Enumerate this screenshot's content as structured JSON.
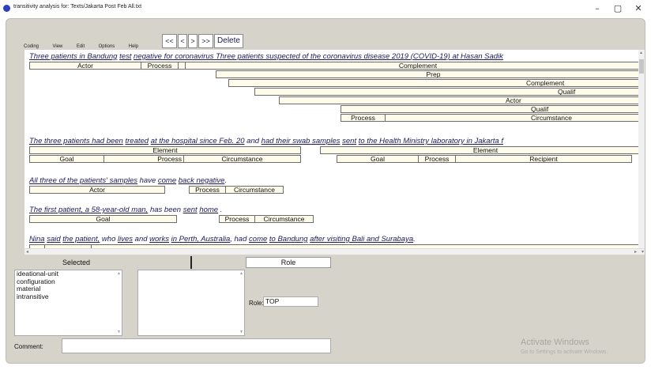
{
  "window": {
    "title": "transitivity analysis for: Texts/Jakarta Post Feb All.txt",
    "minimize": "–",
    "maximize": "▢",
    "close": "✕"
  },
  "menu": [
    "Coding",
    "View",
    "Edit",
    "Options",
    "Help"
  ],
  "toolbar": {
    "first": "<<",
    "prev": "<",
    "next": ">",
    "last": ">>",
    "delete": "Delete"
  },
  "sentences": [
    {
      "segments": [
        {
          "text": "Three patients in Bandung",
          "u": true
        },
        {
          "text": " ",
          "u": false
        },
        {
          "text": "test",
          "u": true
        },
        {
          "text": " ",
          "u": false
        },
        {
          "text": "negative for coronavirus Three patients suspected of the coronavirus disease 2019 (COVID-19) at Hasan Sadik",
          "u": true
        }
      ],
      "boxes": [
        "Actor",
        "Process",
        "",
        "Complement",
        "Prep",
        "Complement",
        "Qualif",
        "Actor",
        "Qualif",
        "Process",
        "Circumstance"
      ]
    },
    {
      "segments": [
        {
          "text": "The three patients had been",
          "u": true
        },
        {
          "text": " ",
          "u": false
        },
        {
          "text": "treated",
          "u": true
        },
        {
          "text": " ",
          "u": false
        },
        {
          "text": "at the hospital since Feb. 20",
          "u": true
        },
        {
          "text": " and ",
          "u": false
        },
        {
          "text": "had their swab samples",
          "u": true
        },
        {
          "text": "   ",
          "u": false
        },
        {
          "text": "sent",
          "u": true
        },
        {
          "text": "   ",
          "u": false
        },
        {
          "text": "to the Health Ministry laboratory in Jakarta f",
          "u": true
        }
      ],
      "boxes": [
        "Element",
        "Element",
        "Goal",
        "Process",
        "Circumstance",
        "Goal",
        "Process",
        "Recipient"
      ]
    },
    {
      "segments": [
        {
          "text": "All three of the patients' samples",
          "u": true
        },
        {
          "text": " have ",
          "u": false
        },
        {
          "text": "come",
          "u": true
        },
        {
          "text": "  ",
          "u": false
        },
        {
          "text": "back negative",
          "u": true
        },
        {
          "text": ".",
          "u": false
        }
      ],
      "boxes": [
        "Actor",
        "Process",
        "Circumstance"
      ]
    },
    {
      "segments": [
        {
          "text": "The first patient, a 58-year-old man,",
          "u": true
        },
        {
          "text": " has been ",
          "u": false
        },
        {
          "text": "sent",
          "u": true
        },
        {
          "text": "       ",
          "u": false
        },
        {
          "text": "home",
          "u": true
        },
        {
          "text": "     .",
          "u": false
        }
      ],
      "boxes": [
        "Goal",
        "Process",
        "Circumstance"
      ]
    },
    {
      "segments": [
        {
          "text": "Nina",
          "u": true
        },
        {
          "text": "   ",
          "u": false
        },
        {
          "text": "said",
          "u": true
        },
        {
          "text": "   ",
          "u": false
        },
        {
          "text": "the patient,",
          "u": true
        },
        {
          "text": " who ",
          "u": false
        },
        {
          "text": "lives",
          "u": true
        },
        {
          "text": "  ",
          "u": false
        },
        {
          "text": "and",
          "u": false
        },
        {
          "text": "  ",
          "u": false
        },
        {
          "text": "works",
          "u": true
        },
        {
          "text": "  ",
          "u": false
        },
        {
          "text": "in Perth, Australia",
          "u": true
        },
        {
          "text": ", had ",
          "u": false
        },
        {
          "text": "come",
          "u": true
        },
        {
          "text": "  ",
          "u": false
        },
        {
          "text": "to Bandung",
          "u": true
        },
        {
          "text": "  ",
          "u": false
        },
        {
          "text": "after visiting Bali and Surabaya",
          "u": true
        },
        {
          "text": ".",
          "u": false
        }
      ],
      "boxes": []
    }
  ],
  "bottom": {
    "selected_label": "Selected",
    "role_label": "Role",
    "selected_items": [
      "ideational-unit",
      "configuration",
      "material",
      "intransitive"
    ],
    "role_field_label": "Role:",
    "role_value": "TOP",
    "comment_label": "Comment:",
    "comment_value": ""
  },
  "watermark": {
    "line1": "Activate Windows",
    "line2": "Go to Settings to activate Windows."
  }
}
